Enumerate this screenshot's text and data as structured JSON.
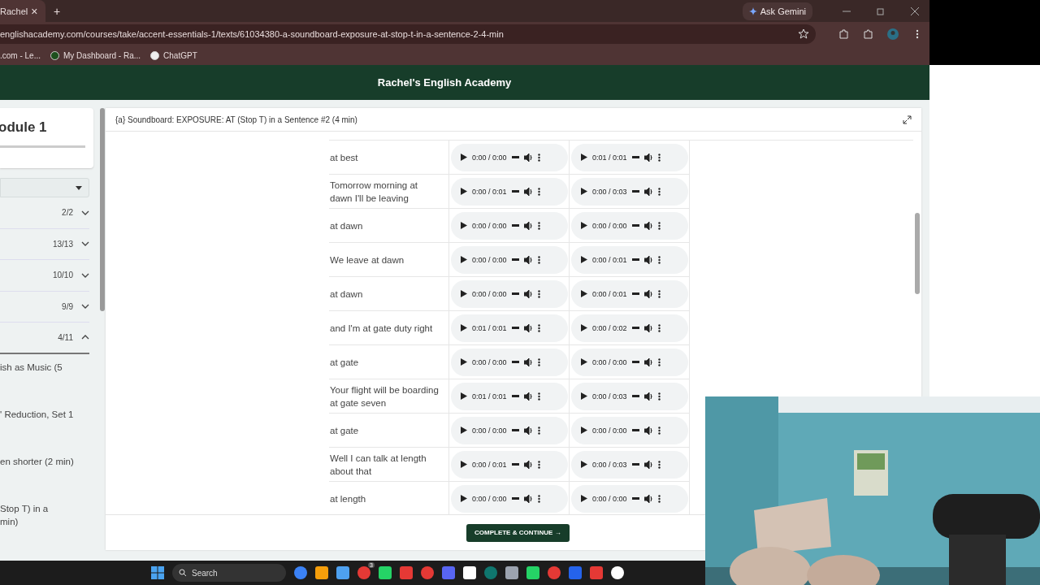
{
  "browser": {
    "tab": {
      "title": "Rachel",
      "close": "×"
    },
    "new_tab": "+",
    "url": "englishacademy.com/courses/take/accent-essentials-1/texts/61034380-a-soundboard-exposure-at-stop-t-in-a-sentence-2-4-min",
    "bookmarks": [
      ".com - Le...",
      "My Dashboard - Ra...",
      "ChatGPT"
    ],
    "gemini": "Ask Gemini"
  },
  "site_title": "Rachel's English Academy",
  "sidebar": {
    "module": "odule 1",
    "sections": [
      {
        "count": "2/2",
        "expanded": false
      },
      {
        "count": "13/13",
        "expanded": false
      },
      {
        "count": "10/10",
        "expanded": false
      },
      {
        "count": "9/9",
        "expanded": false
      },
      {
        "count": "4/11",
        "expanded": true
      }
    ],
    "lessons": [
      "ish as Music (5",
      "' Reduction, Set 1",
      "en shorter (2 min)",
      "Stop T) in a\nmin)"
    ]
  },
  "lesson": {
    "title": "{a} Soundboard: EXPOSURE: AT (Stop T) in a Sentence #2 (4 min)",
    "rows": [
      {
        "text": "at best",
        "audio": [
          "0:00 / 0:00",
          "0:01 / 0:01"
        ]
      },
      {
        "text": "Tomorrow morning at dawn I'll be leaving",
        "audio": [
          "0:00 / 0:01",
          "0:00 / 0:03"
        ]
      },
      {
        "text": "at dawn",
        "audio": [
          "0:00 / 0:00",
          "0:00 / 0:00"
        ]
      },
      {
        "text": "We leave at dawn",
        "audio": [
          "0:00 / 0:00",
          "0:00 / 0:01"
        ]
      },
      {
        "text": "at dawn",
        "audio": [
          "0:00 / 0:00",
          "0:00 / 0:01"
        ]
      },
      {
        "text": "and I'm at gate duty right",
        "audio": [
          "0:01 / 0:01",
          "0:00 / 0:02"
        ]
      },
      {
        "text": "at gate",
        "audio": [
          "0:00 / 0:00",
          "0:00 / 0:00"
        ]
      },
      {
        "text": "Your flight will be boarding at gate seven",
        "audio": [
          "0:01 / 0:01",
          "0:00 / 0:03"
        ]
      },
      {
        "text": "at gate",
        "audio": [
          "0:00 / 0:00",
          "0:00 / 0:00"
        ]
      },
      {
        "text": "Well I can talk at length about that",
        "audio": [
          "0:00 / 0:01",
          "0:00 / 0:03"
        ]
      },
      {
        "text": "at length",
        "audio": [
          "0:00 / 0:00",
          "0:00 / 0:00"
        ]
      }
    ],
    "button": "COMPLETE & CONTINUE →"
  },
  "taskbar": {
    "search": "Search",
    "badge": "3"
  }
}
